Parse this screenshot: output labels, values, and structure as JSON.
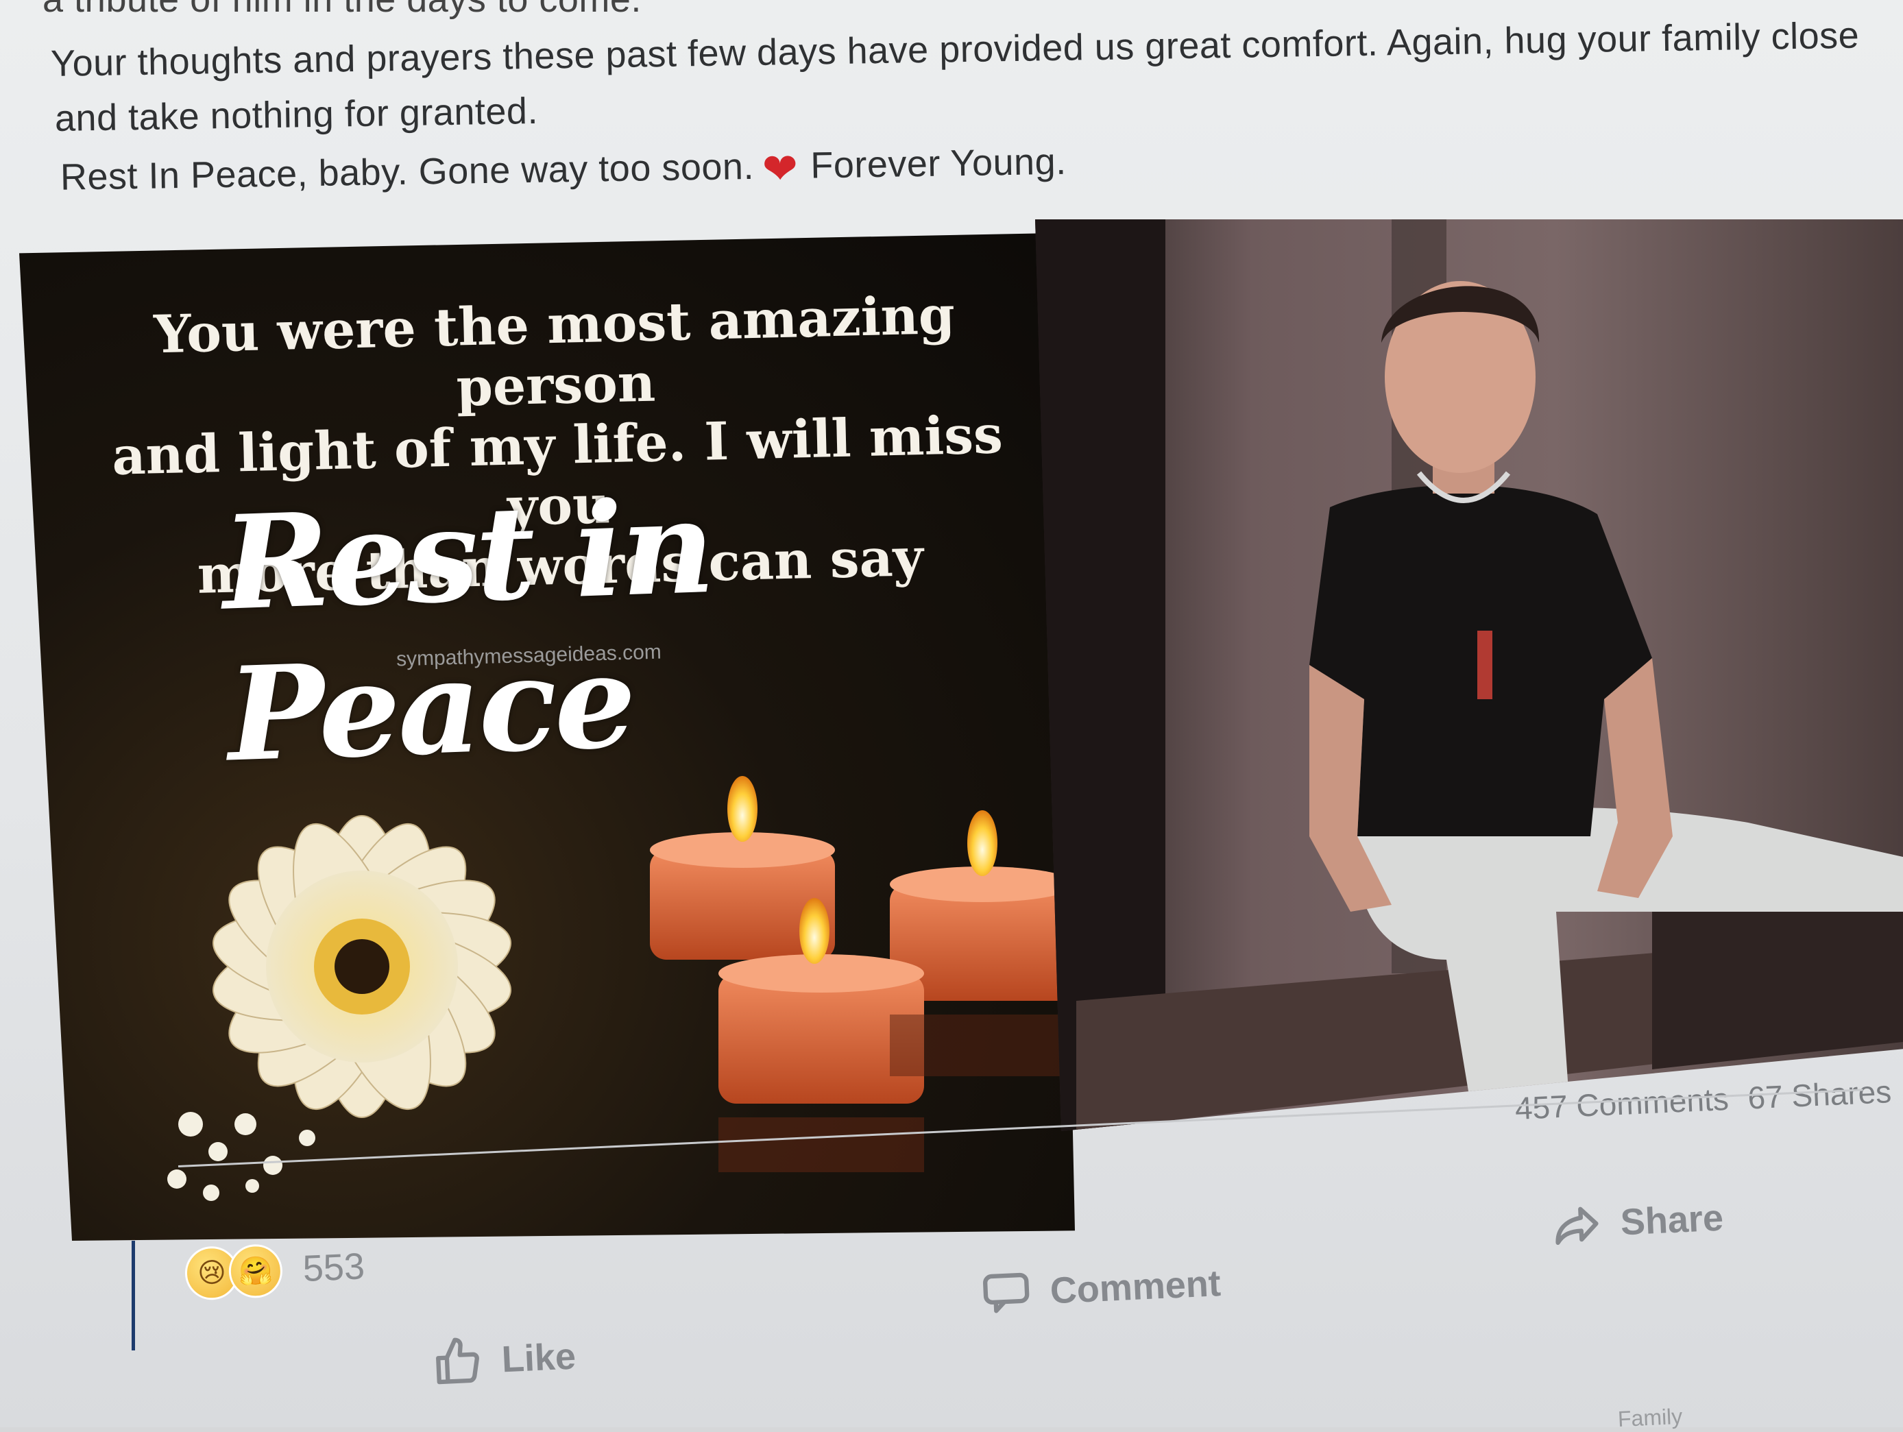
{
  "post": {
    "text_cut_top": "a tribute of him in the days to come.",
    "line1": "Your thoughts and prayers these past few days have provided us great comfort. Again, hug your family close",
    "line2": "and take nothing for granted.",
    "line3_a": "Rest In Peace, baby. Gone way too soon.",
    "line3_heart": "❤",
    "line3_b": "Forever Young."
  },
  "image_left": {
    "quote_line1": "You were the most amazing person",
    "quote_line2": "and light of my life. I will miss you",
    "quote_line3": "more than words can say",
    "title": "Rest in Peace",
    "watermark": "sympathymessageideas.com"
  },
  "stats": {
    "comments": "457 Comments",
    "shares": "67 Shares"
  },
  "reactions": {
    "count": "553",
    "emoji_1": "😢",
    "emoji_2": "🤗"
  },
  "actions": {
    "like": "Like",
    "comment": "Comment",
    "share": "Share"
  },
  "footer": {
    "fragment": "Family"
  },
  "colors": {
    "heart": "#d4262b",
    "action_text": "#86898e",
    "post_text": "#2f3133"
  }
}
